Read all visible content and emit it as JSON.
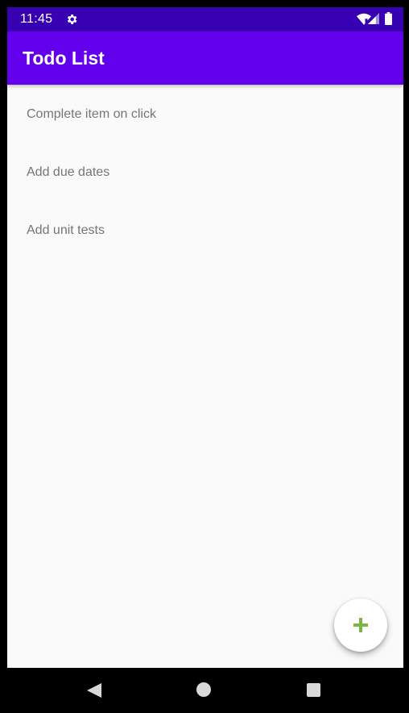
{
  "status_bar": {
    "time": "11:45",
    "icons": [
      "gear-icon",
      "wifi-icon",
      "signal-icon",
      "battery-icon"
    ]
  },
  "app_bar": {
    "title": "Todo List",
    "color": "#6200ee",
    "status_color": "#3700b3"
  },
  "todo_list": {
    "items": [
      {
        "label": "Complete item on click"
      },
      {
        "label": "Add due dates"
      },
      {
        "label": "Add unit tests"
      }
    ]
  },
  "fab": {
    "icon": "plus-icon",
    "icon_color": "#7cb342"
  },
  "navigation_bar": {
    "icons": [
      "back-icon",
      "home-icon",
      "recents-icon"
    ]
  }
}
